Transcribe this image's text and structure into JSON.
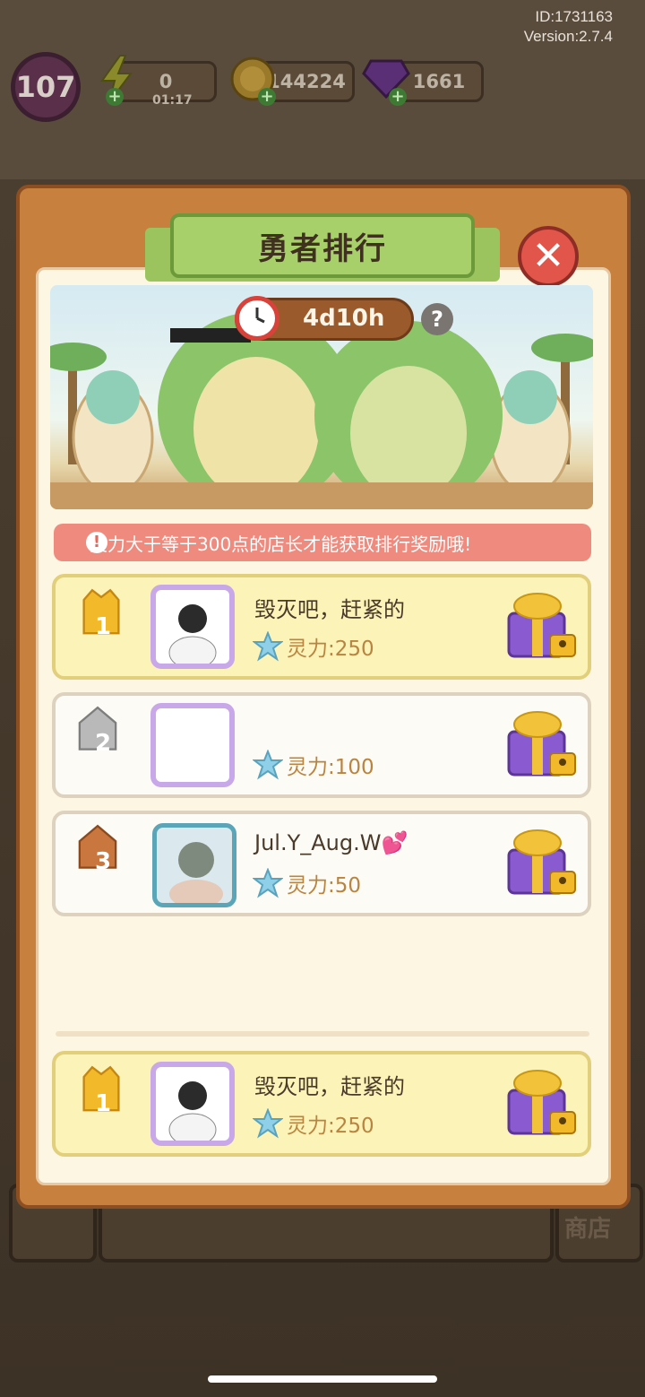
{
  "meta": {
    "id_label": "ID:1731163",
    "version_label": "Version:2.7.4"
  },
  "topbar": {
    "level": "107",
    "energy": "0",
    "energy_timer": "01:17",
    "coins": "144224",
    "gems": "1661"
  },
  "dialog": {
    "title": "勇者排行",
    "countdown": "4d10h",
    "help": "?",
    "notice": "灵力大于等于300点的店长才能获取排行奖励哦!"
  },
  "rankings": [
    {
      "rank": "1",
      "name": "毁灭吧，赶紧的",
      "power": "灵力:250"
    },
    {
      "rank": "2",
      "name": "",
      "power": "灵力:100"
    },
    {
      "rank": "3",
      "name": "Jul.Y_Aug.W💕",
      "power": "灵力:50"
    }
  ],
  "my_rank": {
    "rank": "1",
    "name": "毁灭吧，赶紧的",
    "power": "灵力:250"
  },
  "background": {
    "shop_label": "商店"
  },
  "colors": {
    "panel": "#c8803e",
    "title_green": "#a8d06a",
    "close_red": "#e2554a",
    "notice_bg": "#ef8b7e",
    "gold": "#f2b92a",
    "silver": "#b9b9b9",
    "bronze": "#c9763f",
    "gift_purple": "#8a5bd0"
  }
}
